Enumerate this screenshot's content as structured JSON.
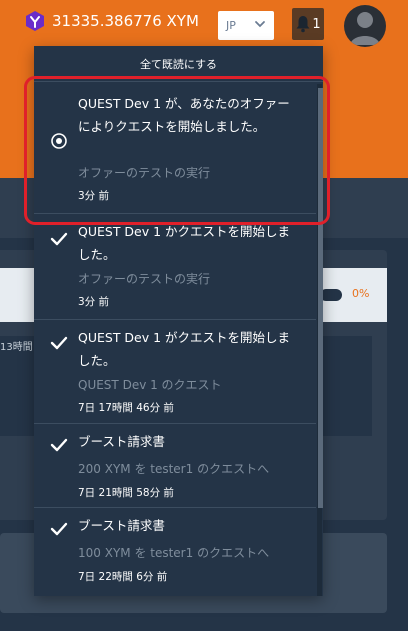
{
  "header": {
    "balance": "31335.386776 XYM",
    "language": "JP",
    "notification_count": "1",
    "colors": {
      "brand": "#e8711c",
      "logo": "#6a2cc9"
    }
  },
  "background": {
    "progress_percent": "0%",
    "progress_fraction": 0,
    "time_fragment": "13時間"
  },
  "notifications": {
    "mark_all_read": "全て既読にする",
    "items": [
      {
        "icon": "radio-dot-icon",
        "title": "QUEST Dev 1 が、あなたのオファーによりクエストを開始しました。",
        "subtitle": "オファーのテストの実行",
        "time": "3分 前"
      },
      {
        "icon": "check-icon",
        "title": "QUEST Dev 1 かクエストを開始しました。",
        "subtitle": "オファーのテストの実行",
        "time": "3分 前"
      },
      {
        "icon": "check-icon",
        "title": "QUEST Dev 1 がクエストを開始しました。",
        "subtitle": "QUEST Dev 1 のクエスト",
        "time": "7日 17時間 46分 前"
      },
      {
        "icon": "check-icon",
        "title": "ブースト請求書",
        "subtitle": "200 XYM を tester1 のクエストへ",
        "time": "7日 21時間 58分 前"
      },
      {
        "icon": "check-icon",
        "title": "ブースト請求書",
        "subtitle": "100 XYM を tester1 のクエストへ",
        "time": "7日 22時間 6分 前"
      }
    ]
  }
}
